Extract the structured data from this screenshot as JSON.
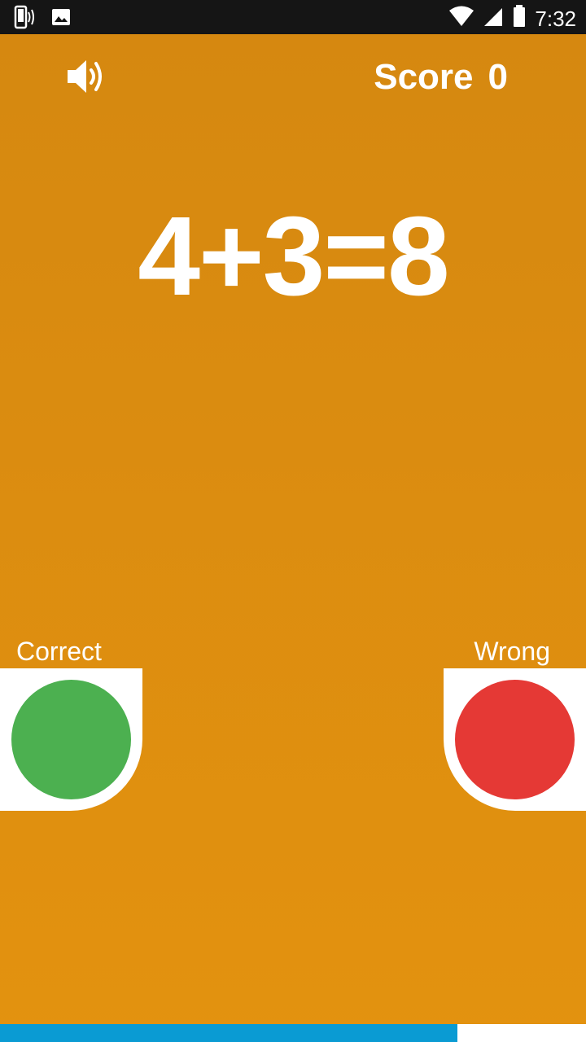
{
  "status_bar": {
    "time": "7:32",
    "icons": [
      "phone-vibrate-icon",
      "image-icon",
      "wifi-icon",
      "signal-icon",
      "battery-icon"
    ]
  },
  "header": {
    "sound_icon": "speaker-icon",
    "score_label": "Score",
    "score_value": "0"
  },
  "equation": "4+3=8",
  "answers": {
    "correct_label": "Correct",
    "wrong_label": "Wrong",
    "correct_color": "#4CB050",
    "wrong_color": "#E53935"
  },
  "timer": {
    "remaining_fraction": 0.78,
    "fill_color": "#0A9BD3"
  },
  "colors": {
    "background_top": "#D58810",
    "background_bottom": "#E3920F"
  }
}
